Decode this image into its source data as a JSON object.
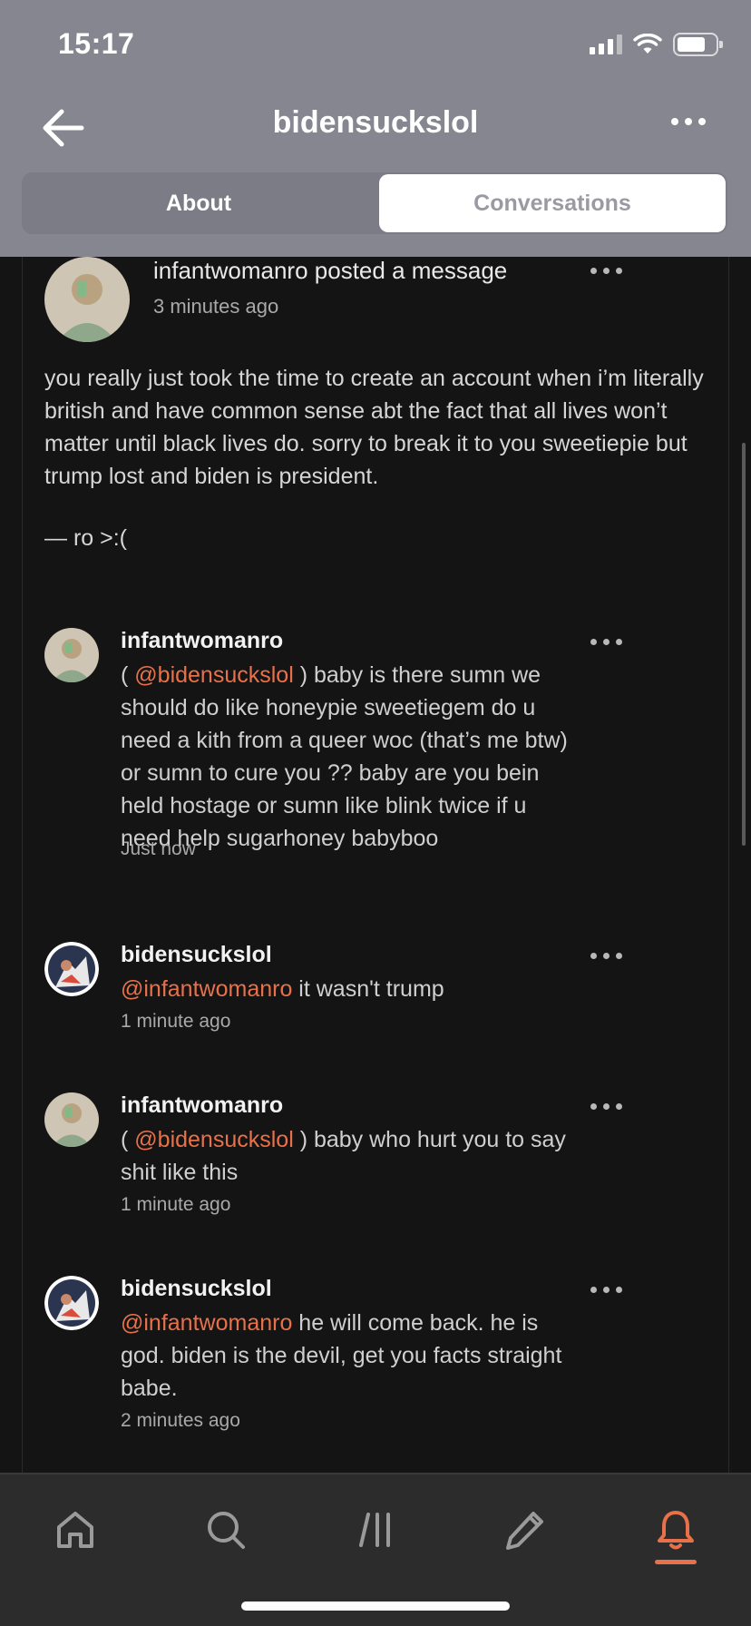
{
  "status_bar": {
    "time": "15:17"
  },
  "header": {
    "title": "bidensuckslol"
  },
  "tabs": [
    {
      "label": "About",
      "active": false
    },
    {
      "label": "Conversations",
      "active": true
    }
  ],
  "post": {
    "author": "infantwomanro",
    "action": "posted a message",
    "time": "3 minutes ago",
    "body": "you really just took the time to create an account when i’m literally british and have common sense abt the fact that all lives won’t matter until black lives do. sorry to break it to you sweetiepie but trump lost and biden is president.",
    "signature": "— ro >:("
  },
  "comments": [
    {
      "author": "infantwomanro",
      "prefix": "( ",
      "mention": "@bidensuckslol",
      "text": " ) baby is there sumn we should do like honeypie sweetiegem do u need a kith from a queer woc (that’s me btw) or sumn to cure you ?? baby are you bein held hostage or sumn like blink twice if u need help sugarhoney babyboo",
      "time": "Just now"
    },
    {
      "author": "bidensuckslol",
      "prefix": "",
      "mention": "@infantwomanro",
      "text": " it wasn't trump",
      "time": "1 minute ago"
    },
    {
      "author": "infantwomanro",
      "prefix": "( ",
      "mention": "@bidensuckslol",
      "text": " ) baby who hurt you to say shit like this",
      "time": "1 minute ago"
    },
    {
      "author": "bidensuckslol",
      "prefix": "",
      "mention": "@infantwomanro",
      "text": " he will come back. he is god. biden is the devil, get you facts straight babe.",
      "time": "2 minutes ago"
    }
  ],
  "nav": {
    "items": [
      "home-icon",
      "search-icon",
      "feed-icon",
      "compose-icon",
      "notifications-icon"
    ],
    "active": "notifications-icon"
  },
  "colors": {
    "accent": "#e8714a",
    "header_bg": "#85868f",
    "feed_bg": "#141414",
    "nav_bg": "#2c2c2d"
  }
}
